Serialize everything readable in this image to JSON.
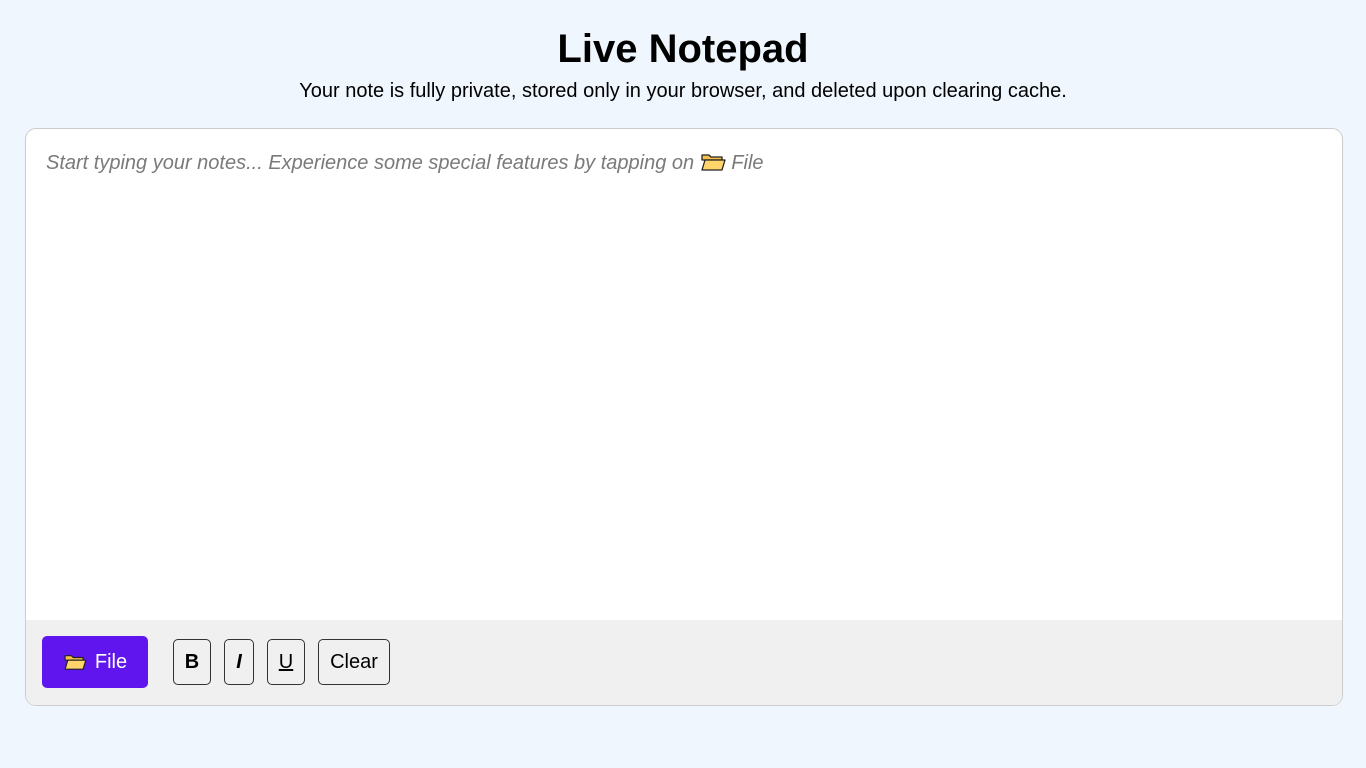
{
  "header": {
    "title": "Live Notepad",
    "subtitle": "Your note is fully private, stored only in your browser, and deleted upon clearing cache."
  },
  "editor": {
    "value": "",
    "placeholder_text": "Start typing your notes... Experience some special features by tapping on",
    "placeholder_icon": "folder-icon",
    "placeholder_file_label": "File"
  },
  "toolbar": {
    "file_label": "File",
    "file_icon": "folder-icon",
    "bold_label": "B",
    "italic_label": "I",
    "underline_label": "U",
    "clear_label": "Clear"
  },
  "colors": {
    "page_background": "#eff6fe",
    "accent": "#6015ee",
    "toolbar_background": "#f0f0f0",
    "placeholder_text": "#7a7a7a"
  }
}
